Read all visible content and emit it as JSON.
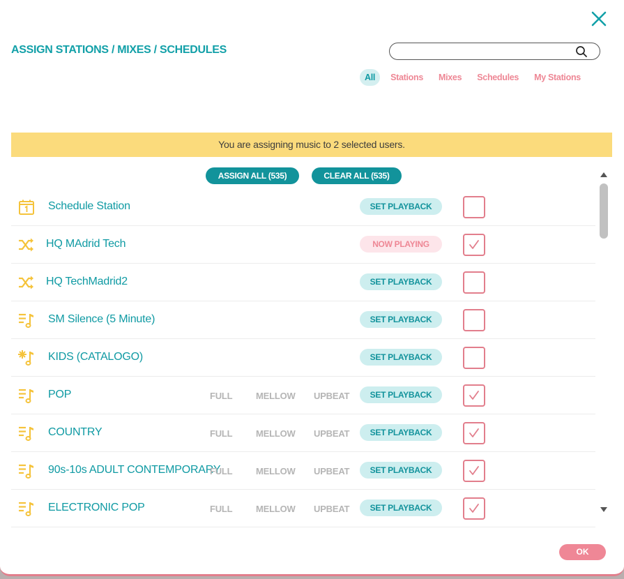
{
  "modal": {
    "title": "ASSIGN STATIONS / MIXES / SCHEDULES",
    "search": {
      "value": "",
      "placeholder": ""
    },
    "filters": [
      "All",
      "Stations",
      "Mixes",
      "Schedules",
      "My Stations"
    ],
    "active_filter": "All",
    "banner": "You are assigning music to 2 selected users.",
    "assign_all_label": "ASSIGN ALL (535)",
    "clear_all_label": "CLEAR ALL (535)",
    "ok_label": "OK"
  },
  "options": {
    "full": "FULL",
    "mellow": "MELLOW",
    "upbeat": "UPBEAT"
  },
  "items": [
    {
      "name": "Schedule Station",
      "icon": "schedule-calendar-icon",
      "status": "SET PLAYBACK",
      "checked": false,
      "options": false
    },
    {
      "name": "HQ MAdrid Tech",
      "icon": "shuffle-mix-icon",
      "status": "NOW PLAYING",
      "checked": true,
      "options": false
    },
    {
      "name": "HQ TechMadrid2",
      "icon": "shuffle-mix-icon",
      "status": "SET PLAYBACK",
      "checked": false,
      "options": false
    },
    {
      "name": "SM Silence (5 Minute)",
      "icon": "playlist-music-icon",
      "status": "SET PLAYBACK",
      "checked": false,
      "options": false
    },
    {
      "name": "KIDS (CATALOGO)",
      "icon": "sparkle-music-icon",
      "status": "SET PLAYBACK",
      "checked": false,
      "options": false
    },
    {
      "name": "POP",
      "icon": "playlist-music-icon",
      "status": "SET PLAYBACK",
      "checked": true,
      "options": true
    },
    {
      "name": "COUNTRY",
      "icon": "playlist-music-icon",
      "status": "SET PLAYBACK",
      "checked": true,
      "options": true
    },
    {
      "name": "90s-10s ADULT CONTEMPORARY",
      "icon": "playlist-music-icon",
      "status": "SET PLAYBACK",
      "checked": true,
      "options": true
    },
    {
      "name": "ELECTRONIC POP",
      "icon": "playlist-music-icon",
      "status": "SET PLAYBACK",
      "checked": true,
      "options": true
    }
  ],
  "colors": {
    "teal": "#12a0a8",
    "pink": "#e27e8c",
    "banner": "#fbdb7c",
    "icon_yellow": "#f5c33b"
  }
}
